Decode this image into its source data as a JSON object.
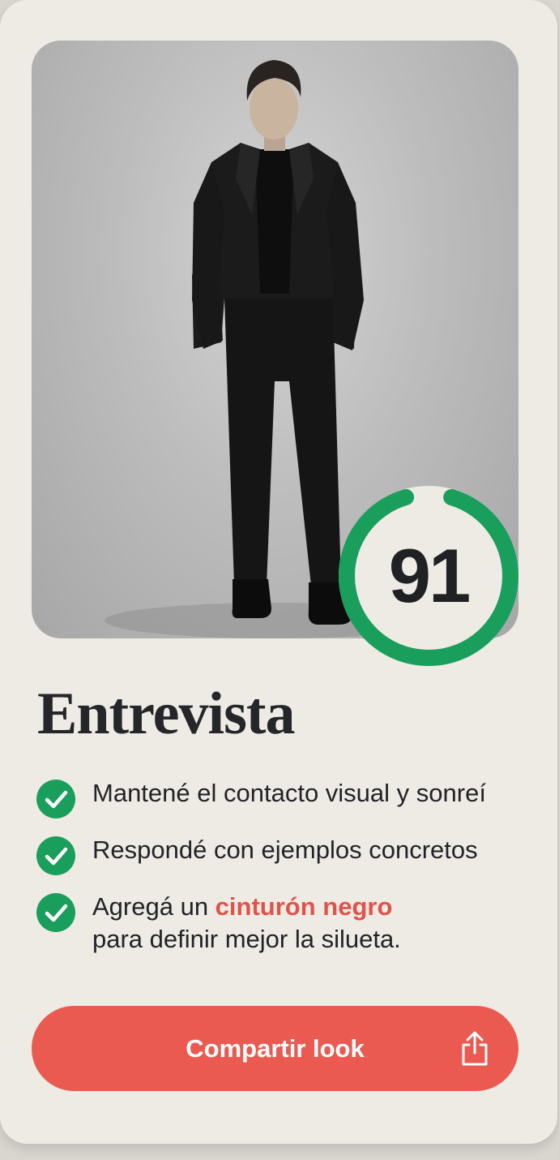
{
  "photo": {
    "subject": "man-in-black-suit"
  },
  "score": {
    "value": "91",
    "progress": 0.91,
    "color": "#1a9e5c"
  },
  "title": "Entrevista",
  "tips": [
    {
      "icon": "check-circle-icon",
      "text": "Mantené el contacto visual y sonreí"
    },
    {
      "icon": "check-circle-icon",
      "text": "Respondé con ejemplos concretos"
    },
    {
      "icon": "check-circle-icon",
      "text_before": "Agregá un ",
      "highlight": "cinturón negro",
      "text_after": "para definir mejor la silueta."
    }
  ],
  "share_button": {
    "label": "Compartir look",
    "icon": "share-icon"
  },
  "colors": {
    "accent": "#ea5a50",
    "success": "#1a9e5c",
    "background": "#eeebe5"
  }
}
